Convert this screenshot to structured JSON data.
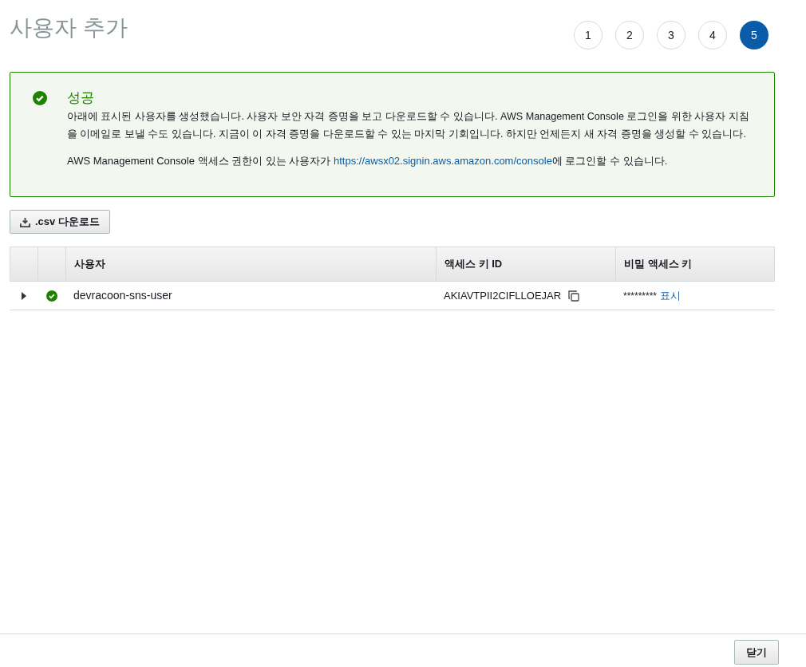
{
  "title": "사용자 추가",
  "steps": [
    {
      "label": "1",
      "selected": false
    },
    {
      "label": "2",
      "selected": false
    },
    {
      "label": "3",
      "selected": false
    },
    {
      "label": "4",
      "selected": false
    },
    {
      "label": "5",
      "selected": true
    }
  ],
  "alert": {
    "kind": "success",
    "heading": "성공",
    "message": "아래에 표시된 사용자를 생성했습니다. 사용자 보안 자격 증명을 보고 다운로드할 수 있습니다. AWS Management Console 로그인을 위한 사용자 지침을 이메일로 보낼 수도 있습니다. 지금이 이 자격 증명을 다운로드할 수 있는 마지막 기회입니다. 하지만 언제든지 새 자격 증명을 생성할 수 있습니다.",
    "login_before": "AWS Management Console 액세스 권한이 있는 사용자가 ",
    "login_link": "https://awsx02.signin.aws.amazon.com/console",
    "login_after": "에 로그인할 수 있습니다."
  },
  "download_button": ".csv 다운로드",
  "table": {
    "columns": [
      "사용자",
      "액세스 키 ID",
      "비밀 액세스 키"
    ],
    "rows": [
      {
        "expanded": false,
        "succeeded": true,
        "user": "devracoon-sns-user",
        "access_key_id": "AKIAVTPII2CIFLLOEJAR",
        "secret": "*********",
        "show_link": "표시"
      }
    ]
  },
  "close_button": "닫기"
}
